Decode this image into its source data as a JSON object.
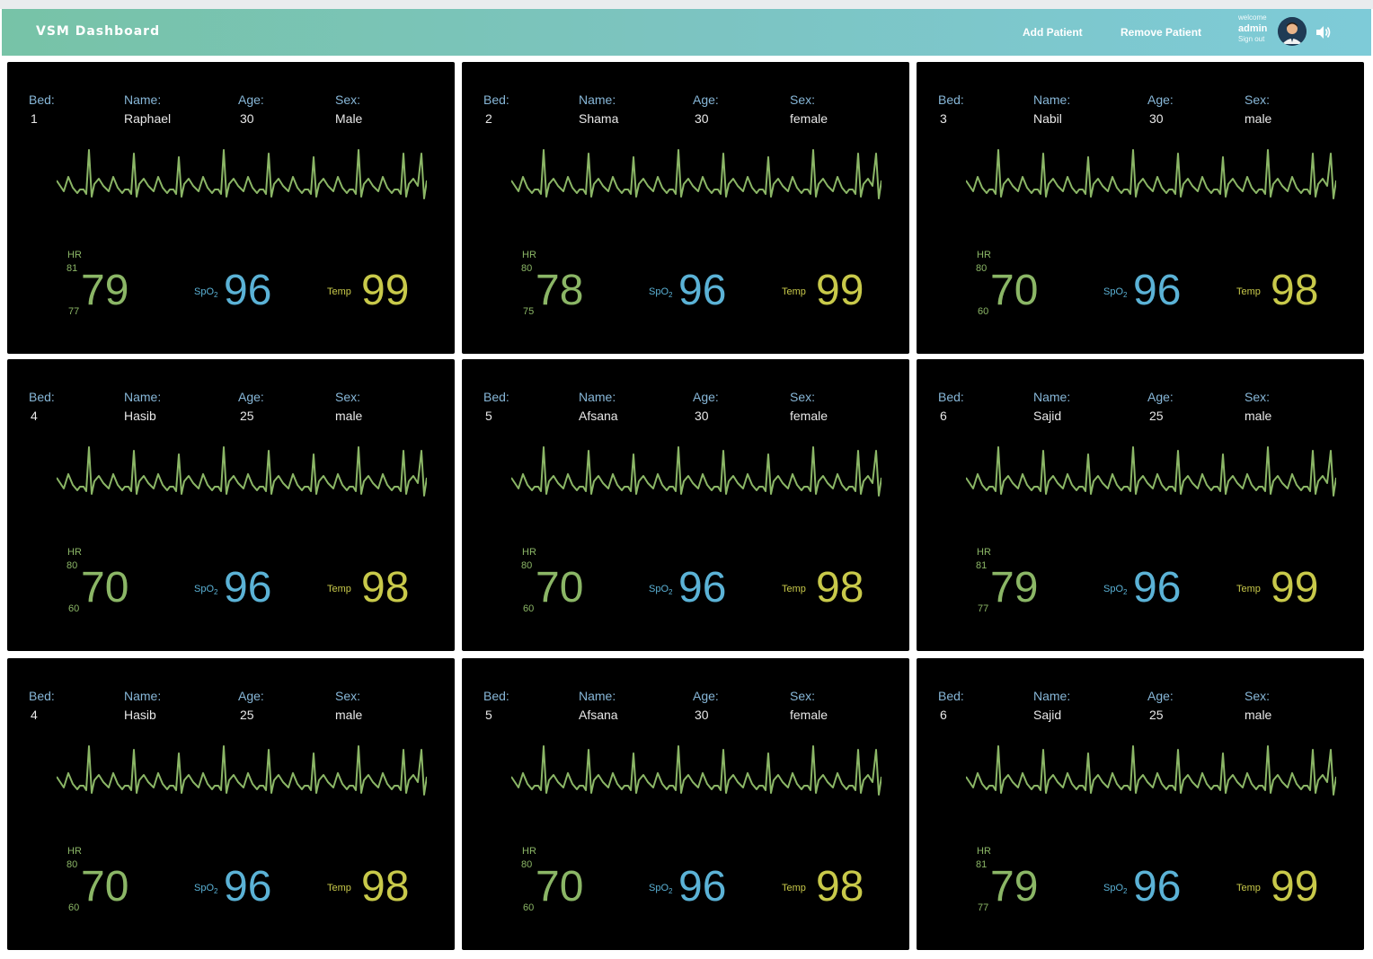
{
  "header": {
    "title": "VSM Dashboard",
    "add_patient": "Add Patient",
    "remove_patient": "Remove Patient",
    "welcome": "welcome",
    "username": "admin",
    "sign_out": "Sign out"
  },
  "labels": {
    "bed": "Bed:",
    "name": "Name:",
    "age": "Age:",
    "sex": "Sex:",
    "hr": "HR",
    "spo2": "SpO",
    "spo2_sub": "2",
    "temp": "Temp"
  },
  "colors": {
    "hr": "#8bb666",
    "spo2": "#5bb2d6",
    "temp": "#c8c94a",
    "label": "#87b7d8",
    "panel_bg": "#000000"
  },
  "patients": [
    {
      "bed": "1",
      "name": "Raphael",
      "age": "30",
      "sex": "Male",
      "hr_high": "81",
      "hr": "79",
      "hr_low": "77",
      "spo2": "96",
      "temp": "99"
    },
    {
      "bed": "2",
      "name": "Shama",
      "age": "30",
      "sex": "female",
      "hr_high": "80",
      "hr": "78",
      "hr_low": "75",
      "spo2": "96",
      "temp": "99"
    },
    {
      "bed": "3",
      "name": "Nabil",
      "age": "30",
      "sex": "male",
      "hr_high": "80",
      "hr": "70",
      "hr_low": "60",
      "spo2": "96",
      "temp": "98"
    },
    {
      "bed": "4",
      "name": "Hasib",
      "age": "25",
      "sex": "male",
      "hr_high": "80",
      "hr": "70",
      "hr_low": "60",
      "spo2": "96",
      "temp": "98"
    },
    {
      "bed": "5",
      "name": "Afsana",
      "age": "30",
      "sex": "female",
      "hr_high": "80",
      "hr": "70",
      "hr_low": "60",
      "spo2": "96",
      "temp": "98"
    },
    {
      "bed": "6",
      "name": "Sajid",
      "age": "25",
      "sex": "male",
      "hr_high": "81",
      "hr": "79",
      "hr_low": "77",
      "spo2": "96",
      "temp": "99"
    },
    {
      "bed": "4",
      "name": "Hasib",
      "age": "25",
      "sex": "male",
      "hr_high": "80",
      "hr": "70",
      "hr_low": "60",
      "spo2": "96",
      "temp": "98"
    },
    {
      "bed": "5",
      "name": "Afsana",
      "age": "30",
      "sex": "female",
      "hr_high": "80",
      "hr": "70",
      "hr_low": "60",
      "spo2": "96",
      "temp": "98"
    },
    {
      "bed": "6",
      "name": "Sajid",
      "age": "25",
      "sex": "male",
      "hr_high": "81",
      "hr": "79",
      "hr_low": "77",
      "spo2": "96",
      "temp": "99"
    }
  ]
}
